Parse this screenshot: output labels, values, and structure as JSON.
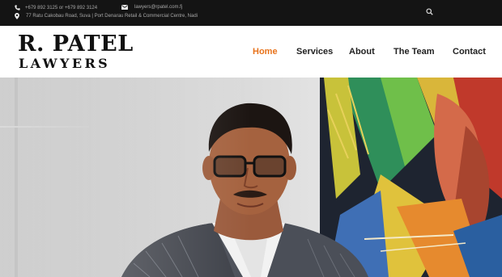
{
  "topbar": {
    "phone": "+679 892 3125 or +679 892 3124",
    "email": "lawyers@rpatel.com.fj",
    "address": "77 Ratu Cakobau Road, Suva | Port Denarau Retail & Commercial Centre, Nadi",
    "icons": {
      "phone": "phone-icon",
      "email": "envelope-icon",
      "address": "map-pin-icon",
      "search": "search-icon"
    }
  },
  "logo": {
    "line1": "R. PATEL",
    "line2": "LAWYERS"
  },
  "nav": {
    "items": [
      "Home",
      "Services",
      "About",
      "The Team",
      "Contact"
    ],
    "active": "Home"
  },
  "colors": {
    "accent": "#e8731c",
    "topbar_bg": "#141414",
    "nav_text": "#222222"
  }
}
